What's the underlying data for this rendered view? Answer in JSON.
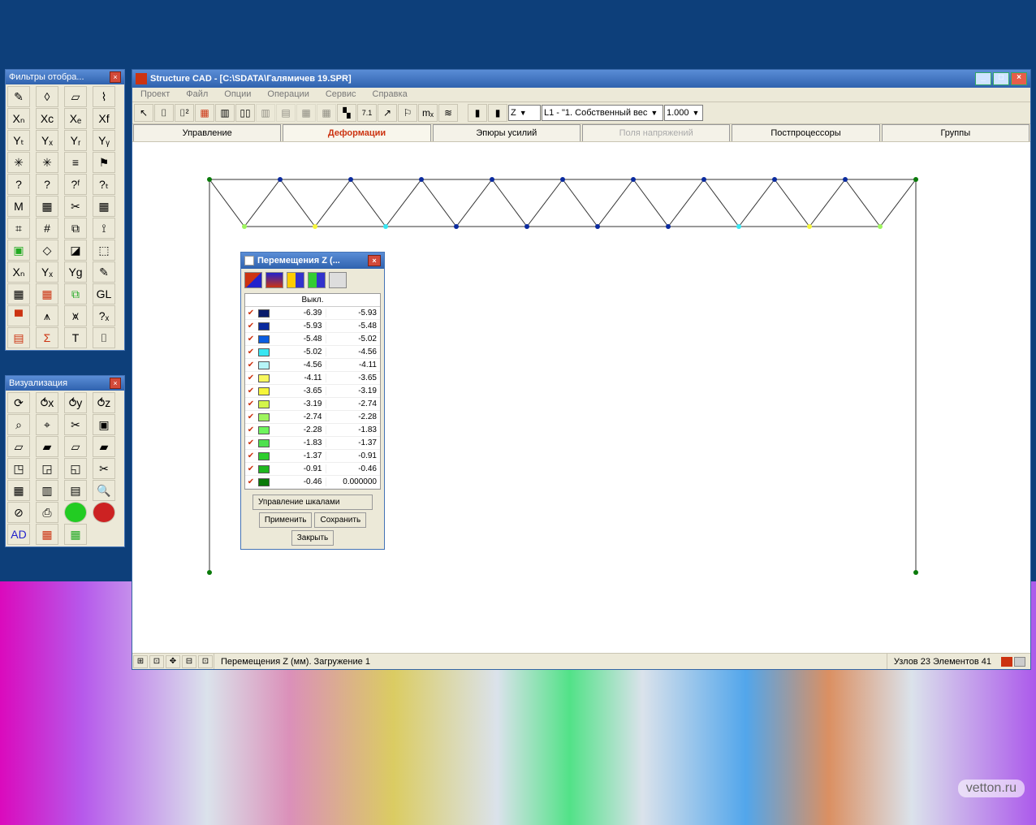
{
  "palettes": {
    "filters": {
      "title": "Фильтры отобра..."
    },
    "viz": {
      "title": "Визуализация"
    }
  },
  "app": {
    "title": "Structure CAD  - [C:\\SDATA\\Галямичев 19.SPR]",
    "menus": [
      "Проект",
      "Файл",
      "Опции",
      "Операции",
      "Сервис",
      "Справка"
    ],
    "combos": {
      "axis": "Z",
      "load": "L1 - \"1. Собственный вес",
      "scale": "1.000"
    },
    "tabs": {
      "0": "Управление",
      "1": "Деформации",
      "2": "Эпюры усилий",
      "3": "Поля напряжений",
      "4": "Постпроцессоры",
      "5": "Группы",
      "active": 1,
      "disabled": 3
    },
    "status": {
      "left": "Перемещения Z (мм). Загружение 1",
      "right": "Узлов 23 Элементов 41"
    }
  },
  "legend": {
    "title": "Перемещения Z (...",
    "off_label": "Выкл.",
    "rows": [
      {
        "c": "#081a6b",
        "a": "-6.39",
        "b": "-5.93"
      },
      {
        "c": "#0a2a9e",
        "a": "-5.93",
        "b": "-5.48"
      },
      {
        "c": "#0a5de0",
        "a": "-5.48",
        "b": "-5.02"
      },
      {
        "c": "#38e6f2",
        "a": "-5.02",
        "b": "-4.56"
      },
      {
        "c": "#b6f5f8",
        "a": "-4.56",
        "b": "-4.11"
      },
      {
        "c": "#f8f85e",
        "a": "-4.11",
        "b": "-3.65"
      },
      {
        "c": "#f5f53a",
        "a": "-3.65",
        "b": "-3.19"
      },
      {
        "c": "#d4f54a",
        "a": "-3.19",
        "b": "-2.74"
      },
      {
        "c": "#9ef55e",
        "a": "-2.74",
        "b": "-2.28"
      },
      {
        "c": "#6ef55e",
        "a": "-2.28",
        "b": "-1.83"
      },
      {
        "c": "#4ee04e",
        "a": "-1.83",
        "b": "-1.37"
      },
      {
        "c": "#2ece2e",
        "a": "-1.37",
        "b": "-0.91"
      },
      {
        "c": "#1fb71f",
        "a": "-0.91",
        "b": "-0.46"
      },
      {
        "c": "#0a7a0a",
        "a": "-0.46",
        "b": "0.000000"
      }
    ],
    "buttons": {
      "scales": "Управление шкалами",
      "apply": "Применить",
      "save": "Сохранить",
      "close": "Закрыть"
    }
  },
  "watermark": "vetton.ru"
}
